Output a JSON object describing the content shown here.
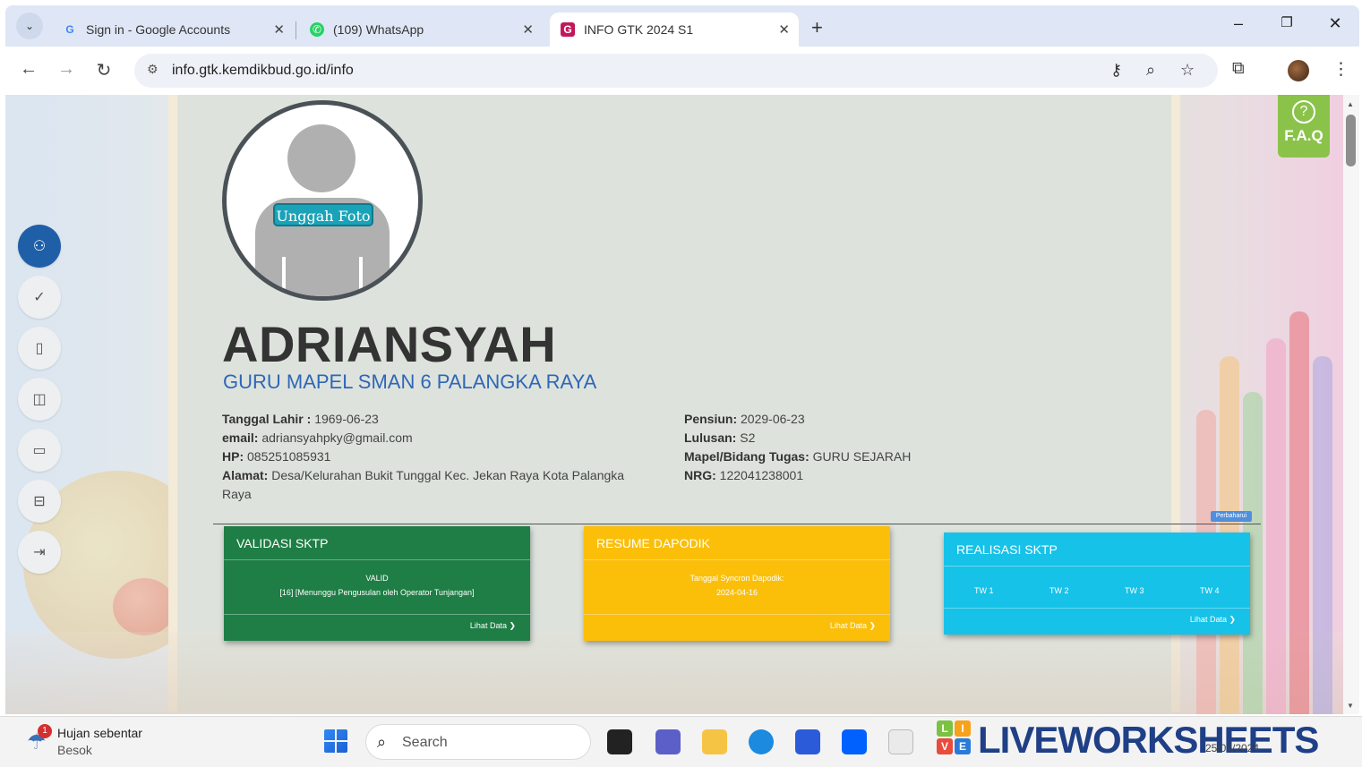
{
  "browser": {
    "tabs": [
      {
        "title": "Sign in - Google Accounts",
        "favicon": "G",
        "favicon_color": "#4285f4"
      },
      {
        "title": "(109) WhatsApp",
        "favicon": "✆",
        "favicon_color": "#25d366"
      },
      {
        "title": "INFO GTK 2024 S1",
        "favicon": "G",
        "favicon_color": "#c2185b"
      }
    ],
    "new_tab_symbol": "+",
    "url": "info.gtk.kemdikbud.go.id/info"
  },
  "profile": {
    "upload_photo_label": "Unggah Foto",
    "name": "ADRIANSYAH",
    "position": "GURU MAPEL SMAN 6 PALANGKA RAYA",
    "left_fields": [
      {
        "label": "Tanggal Lahir :",
        "value": "1969-06-23"
      },
      {
        "label": "email:",
        "value": "adriansyahpky@gmail.com"
      },
      {
        "label": "HP:",
        "value": "085251085931"
      },
      {
        "label": "Alamat:",
        "value": "Desa/Kelurahan Bukit Tunggal Kec. Jekan Raya Kota Palangka Raya"
      }
    ],
    "right_fields": [
      {
        "label": "Pensiun:",
        "value": "2029-06-23"
      },
      {
        "label": "Lulusan:",
        "value": "S2"
      },
      {
        "label": "Mapel/Bidang Tugas:",
        "value": "GURU SEJARAH"
      },
      {
        "label": "NRG:",
        "value": "122041238001"
      }
    ],
    "update_badge": "Perbaharui"
  },
  "cards": {
    "validasi": {
      "title": "VALIDASI SKTP",
      "line1": "VALID",
      "line2": "[16] [Menunggu Pengusulan oleh Operator Tunjangan]",
      "link": "Lihat Data ❯",
      "color": "#1e7e45"
    },
    "resume": {
      "title": "RESUME DAPODIK",
      "line1": "Tanggal Syncron Dapodik:",
      "line2": "2024-04-16",
      "link": "Lihat Data ❯",
      "color": "#fbbf0a"
    },
    "realisasi": {
      "title": "REALISASI SKTP",
      "tw": [
        "TW 1",
        "TW 2",
        "TW 3",
        "TW 4"
      ],
      "link": "Lihat Data ❯",
      "color": "#16c2e8"
    }
  },
  "faq": {
    "label": "F.A.Q",
    "symbol": "?"
  },
  "taskbar": {
    "weather_title": "Hujan sebentar",
    "weather_sub": "Besok",
    "notification_count": "1",
    "search_placeholder": "Search",
    "watermark": "LIVEWORKSHEETS",
    "date": "25/04/2024"
  },
  "icons": [
    "chevron-down-icon",
    "close-icon",
    "back-icon",
    "forward-icon",
    "reload-icon",
    "site-settings-icon",
    "password-key-icon",
    "zoom-icon",
    "star-icon",
    "extensions-icon",
    "menu-icon",
    "user-icon",
    "check-icon",
    "file-icon",
    "book-icon",
    "folder-icon",
    "archive-icon",
    "logout-icon"
  ]
}
